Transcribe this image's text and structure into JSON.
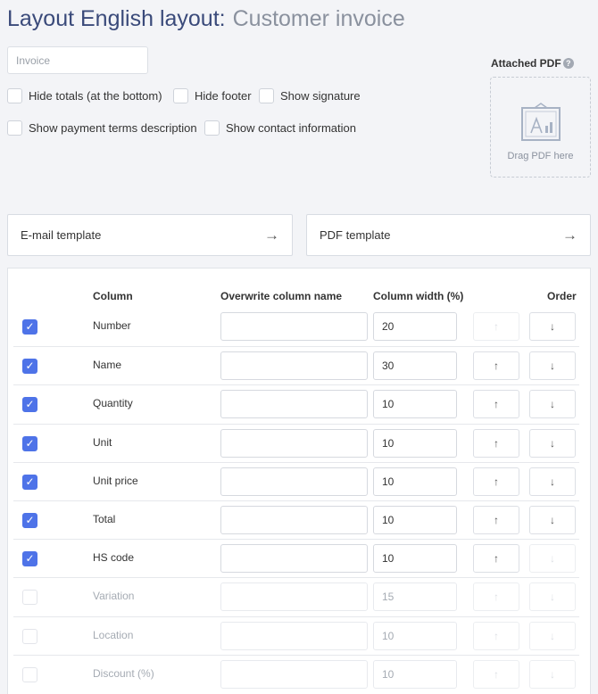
{
  "header": {
    "title": "Layout English layout:",
    "subtitle": "Customer invoice"
  },
  "name_field": {
    "placeholder": "Invoice",
    "value": ""
  },
  "options": [
    {
      "label": "Hide totals (at the bottom)",
      "checked": false
    },
    {
      "label": "Hide footer",
      "checked": false
    },
    {
      "label": "Show signature",
      "checked": false
    },
    {
      "label": "Show payment terms description",
      "checked": false
    },
    {
      "label": "Show contact information",
      "checked": false
    }
  ],
  "attached_pdf": {
    "label": "Attached PDF",
    "help_icon": "question-icon",
    "drop_text": "Drag PDF here",
    "icon": "pdf-image-icon"
  },
  "templates": {
    "email": {
      "label": "E-mail template",
      "arrow": "→"
    },
    "pdf": {
      "label": "PDF template",
      "arrow": "→"
    }
  },
  "table": {
    "headers": {
      "column": "Column",
      "overwrite": "Overwrite column name",
      "width": "Column width (%)",
      "order": "Order"
    },
    "up_glyph": "↑",
    "down_glyph": "↓",
    "check_glyph": "✓",
    "rows": [
      {
        "name": "Number",
        "enabled": true,
        "overwrite": "",
        "width": "20",
        "up_enabled": false,
        "down_enabled": true
      },
      {
        "name": "Name",
        "enabled": true,
        "overwrite": "",
        "width": "30",
        "up_enabled": true,
        "down_enabled": true
      },
      {
        "name": "Quantity",
        "enabled": true,
        "overwrite": "",
        "width": "10",
        "up_enabled": true,
        "down_enabled": true
      },
      {
        "name": "Unit",
        "enabled": true,
        "overwrite": "",
        "width": "10",
        "up_enabled": true,
        "down_enabled": true
      },
      {
        "name": "Unit price",
        "enabled": true,
        "overwrite": "",
        "width": "10",
        "up_enabled": true,
        "down_enabled": true
      },
      {
        "name": "Total",
        "enabled": true,
        "overwrite": "",
        "width": "10",
        "up_enabled": true,
        "down_enabled": true
      },
      {
        "name": "HS code",
        "enabled": true,
        "overwrite": "",
        "width": "10",
        "up_enabled": true,
        "down_enabled": false
      },
      {
        "name": "Variation",
        "enabled": false,
        "overwrite": "",
        "width": "15",
        "up_enabled": false,
        "down_enabled": false
      },
      {
        "name": "Location",
        "enabled": false,
        "overwrite": "",
        "width": "10",
        "up_enabled": false,
        "down_enabled": false
      },
      {
        "name": "Discount (%)",
        "enabled": false,
        "overwrite": "",
        "width": "10",
        "up_enabled": false,
        "down_enabled": false
      }
    ]
  },
  "colors": {
    "accent": "#4e73e8",
    "title": "#3a4a7a",
    "subtitle": "#8a919e",
    "background": "#f3f4f7"
  }
}
